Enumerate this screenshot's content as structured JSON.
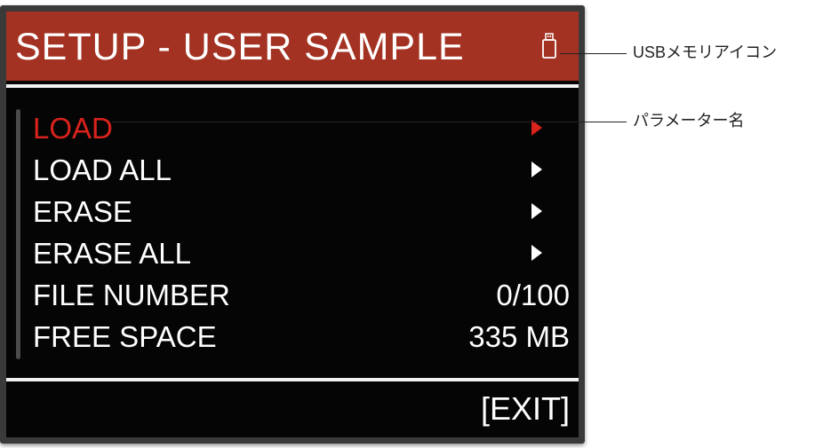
{
  "screen": {
    "title": "SETUP - USER SAMPLE",
    "title_bar_color": "#a33222",
    "status_icon": "usb-memory-icon",
    "menu_items": [
      {
        "label": "LOAD",
        "value": "",
        "icon": "arrow-right-icon",
        "selected": true
      },
      {
        "label": "LOAD ALL",
        "value": "",
        "icon": "arrow-right-icon",
        "selected": false
      },
      {
        "label": "ERASE",
        "value": "",
        "icon": "arrow-right-icon",
        "selected": false
      },
      {
        "label": "ERASE ALL",
        "value": "",
        "icon": "arrow-right-icon",
        "selected": false
      },
      {
        "label": "FILE NUMBER",
        "value": "0/100",
        "icon": "",
        "selected": false
      },
      {
        "label": "FREE SPACE",
        "value": "335 MB",
        "icon": "",
        "selected": false
      }
    ],
    "selected_color": "#d9231c",
    "exit_label": "[EXIT]"
  },
  "callouts": {
    "usb_icon": "USBメモリアイコン",
    "parameter_name": "パラメーター名"
  }
}
